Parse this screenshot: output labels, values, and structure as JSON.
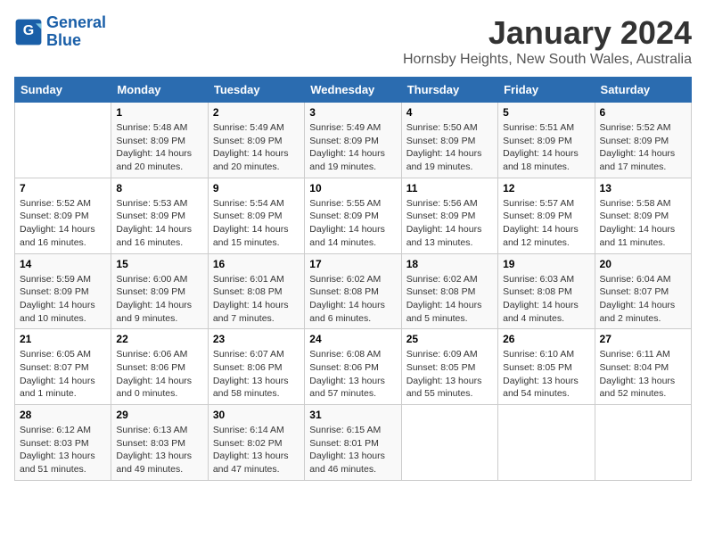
{
  "header": {
    "logo_line1": "General",
    "logo_line2": "Blue",
    "title": "January 2024",
    "subtitle": "Hornsby Heights, New South Wales, Australia"
  },
  "weekdays": [
    "Sunday",
    "Monday",
    "Tuesday",
    "Wednesday",
    "Thursday",
    "Friday",
    "Saturday"
  ],
  "weeks": [
    [
      {
        "day": "",
        "sunrise": "",
        "sunset": "",
        "daylight": ""
      },
      {
        "day": "1",
        "sunrise": "Sunrise: 5:48 AM",
        "sunset": "Sunset: 8:09 PM",
        "daylight": "Daylight: 14 hours and 20 minutes."
      },
      {
        "day": "2",
        "sunrise": "Sunrise: 5:49 AM",
        "sunset": "Sunset: 8:09 PM",
        "daylight": "Daylight: 14 hours and 20 minutes."
      },
      {
        "day": "3",
        "sunrise": "Sunrise: 5:49 AM",
        "sunset": "Sunset: 8:09 PM",
        "daylight": "Daylight: 14 hours and 19 minutes."
      },
      {
        "day": "4",
        "sunrise": "Sunrise: 5:50 AM",
        "sunset": "Sunset: 8:09 PM",
        "daylight": "Daylight: 14 hours and 19 minutes."
      },
      {
        "day": "5",
        "sunrise": "Sunrise: 5:51 AM",
        "sunset": "Sunset: 8:09 PM",
        "daylight": "Daylight: 14 hours and 18 minutes."
      },
      {
        "day": "6",
        "sunrise": "Sunrise: 5:52 AM",
        "sunset": "Sunset: 8:09 PM",
        "daylight": "Daylight: 14 hours and 17 minutes."
      }
    ],
    [
      {
        "day": "7",
        "sunrise": "Sunrise: 5:52 AM",
        "sunset": "Sunset: 8:09 PM",
        "daylight": "Daylight: 14 hours and 16 minutes."
      },
      {
        "day": "8",
        "sunrise": "Sunrise: 5:53 AM",
        "sunset": "Sunset: 8:09 PM",
        "daylight": "Daylight: 14 hours and 16 minutes."
      },
      {
        "day": "9",
        "sunrise": "Sunrise: 5:54 AM",
        "sunset": "Sunset: 8:09 PM",
        "daylight": "Daylight: 14 hours and 15 minutes."
      },
      {
        "day": "10",
        "sunrise": "Sunrise: 5:55 AM",
        "sunset": "Sunset: 8:09 PM",
        "daylight": "Daylight: 14 hours and 14 minutes."
      },
      {
        "day": "11",
        "sunrise": "Sunrise: 5:56 AM",
        "sunset": "Sunset: 8:09 PM",
        "daylight": "Daylight: 14 hours and 13 minutes."
      },
      {
        "day": "12",
        "sunrise": "Sunrise: 5:57 AM",
        "sunset": "Sunset: 8:09 PM",
        "daylight": "Daylight: 14 hours and 12 minutes."
      },
      {
        "day": "13",
        "sunrise": "Sunrise: 5:58 AM",
        "sunset": "Sunset: 8:09 PM",
        "daylight": "Daylight: 14 hours and 11 minutes."
      }
    ],
    [
      {
        "day": "14",
        "sunrise": "Sunrise: 5:59 AM",
        "sunset": "Sunset: 8:09 PM",
        "daylight": "Daylight: 14 hours and 10 minutes."
      },
      {
        "day": "15",
        "sunrise": "Sunrise: 6:00 AM",
        "sunset": "Sunset: 8:09 PM",
        "daylight": "Daylight: 14 hours and 9 minutes."
      },
      {
        "day": "16",
        "sunrise": "Sunrise: 6:01 AM",
        "sunset": "Sunset: 8:08 PM",
        "daylight": "Daylight: 14 hours and 7 minutes."
      },
      {
        "day": "17",
        "sunrise": "Sunrise: 6:02 AM",
        "sunset": "Sunset: 8:08 PM",
        "daylight": "Daylight: 14 hours and 6 minutes."
      },
      {
        "day": "18",
        "sunrise": "Sunrise: 6:02 AM",
        "sunset": "Sunset: 8:08 PM",
        "daylight": "Daylight: 14 hours and 5 minutes."
      },
      {
        "day": "19",
        "sunrise": "Sunrise: 6:03 AM",
        "sunset": "Sunset: 8:08 PM",
        "daylight": "Daylight: 14 hours and 4 minutes."
      },
      {
        "day": "20",
        "sunrise": "Sunrise: 6:04 AM",
        "sunset": "Sunset: 8:07 PM",
        "daylight": "Daylight: 14 hours and 2 minutes."
      }
    ],
    [
      {
        "day": "21",
        "sunrise": "Sunrise: 6:05 AM",
        "sunset": "Sunset: 8:07 PM",
        "daylight": "Daylight: 14 hours and 1 minute."
      },
      {
        "day": "22",
        "sunrise": "Sunrise: 6:06 AM",
        "sunset": "Sunset: 8:06 PM",
        "daylight": "Daylight: 14 hours and 0 minutes."
      },
      {
        "day": "23",
        "sunrise": "Sunrise: 6:07 AM",
        "sunset": "Sunset: 8:06 PM",
        "daylight": "Daylight: 13 hours and 58 minutes."
      },
      {
        "day": "24",
        "sunrise": "Sunrise: 6:08 AM",
        "sunset": "Sunset: 8:06 PM",
        "daylight": "Daylight: 13 hours and 57 minutes."
      },
      {
        "day": "25",
        "sunrise": "Sunrise: 6:09 AM",
        "sunset": "Sunset: 8:05 PM",
        "daylight": "Daylight: 13 hours and 55 minutes."
      },
      {
        "day": "26",
        "sunrise": "Sunrise: 6:10 AM",
        "sunset": "Sunset: 8:05 PM",
        "daylight": "Daylight: 13 hours and 54 minutes."
      },
      {
        "day": "27",
        "sunrise": "Sunrise: 6:11 AM",
        "sunset": "Sunset: 8:04 PM",
        "daylight": "Daylight: 13 hours and 52 minutes."
      }
    ],
    [
      {
        "day": "28",
        "sunrise": "Sunrise: 6:12 AM",
        "sunset": "Sunset: 8:03 PM",
        "daylight": "Daylight: 13 hours and 51 minutes."
      },
      {
        "day": "29",
        "sunrise": "Sunrise: 6:13 AM",
        "sunset": "Sunset: 8:03 PM",
        "daylight": "Daylight: 13 hours and 49 minutes."
      },
      {
        "day": "30",
        "sunrise": "Sunrise: 6:14 AM",
        "sunset": "Sunset: 8:02 PM",
        "daylight": "Daylight: 13 hours and 47 minutes."
      },
      {
        "day": "31",
        "sunrise": "Sunrise: 6:15 AM",
        "sunset": "Sunset: 8:01 PM",
        "daylight": "Daylight: 13 hours and 46 minutes."
      },
      {
        "day": "",
        "sunrise": "",
        "sunset": "",
        "daylight": ""
      },
      {
        "day": "",
        "sunrise": "",
        "sunset": "",
        "daylight": ""
      },
      {
        "day": "",
        "sunrise": "",
        "sunset": "",
        "daylight": ""
      }
    ]
  ]
}
